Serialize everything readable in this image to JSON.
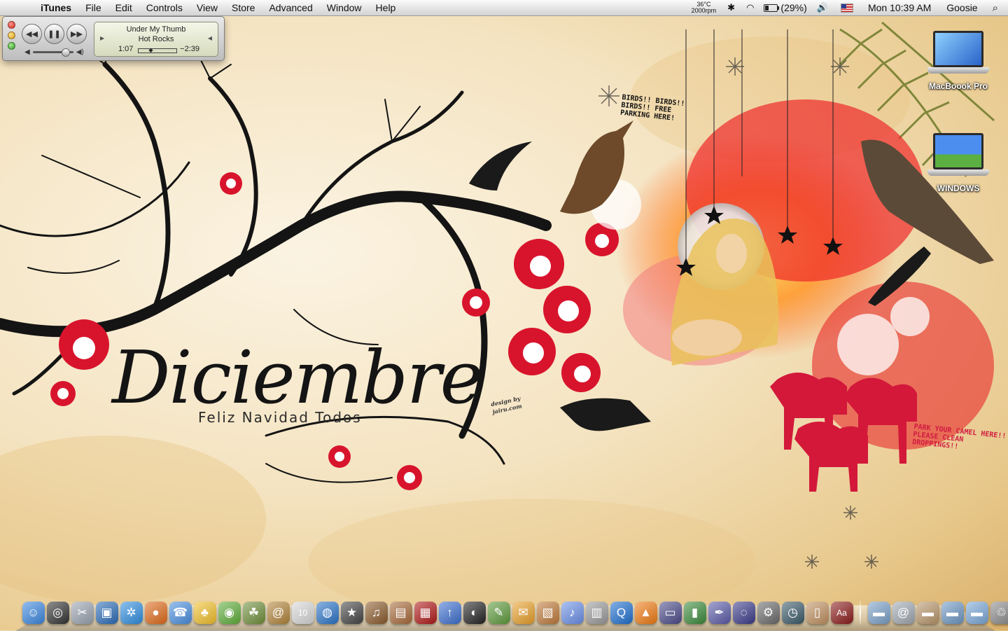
{
  "menubar": {
    "apple": "",
    "app": "iTunes",
    "menus": [
      "File",
      "Edit",
      "Controls",
      "View",
      "Store",
      "Advanced",
      "Window",
      "Help"
    ],
    "temperature": "36°C",
    "fan_speed": "2000rpm",
    "battery_text": "(29%)",
    "battery_level": 0.29,
    "clock": "Mon 10:39 AM",
    "user": "Goosie"
  },
  "player": {
    "song": "Under My Thumb",
    "album": "Hot Rocks",
    "elapsed": "1:07",
    "remaining": "−2:39",
    "progress": 0.3,
    "volume": 0.85
  },
  "wallpaper": {
    "title": "Diciembre",
    "subtitle": "Feliz Navidad Todos",
    "birds_text": "BIRDS!! BIRDS!! BIRDS!! FREE PARKING HERE!",
    "camel_text": "PARK YOUR CAMEL HERE!! PLEASE CLEAN DROPPINGS!!",
    "credit": "design by jairu.com"
  },
  "desktop": {
    "icons": [
      {
        "label": "MacBoook Pro",
        "icon": "macbook-pro-drive",
        "color": "#3b7fd9"
      },
      {
        "label": "WINDOWS",
        "icon": "windows-drive",
        "color": "#3c8de0"
      }
    ]
  },
  "dock": {
    "apps": [
      {
        "name": "finder",
        "glyph": "☺",
        "color": "#3b87e0"
      },
      {
        "name": "dashboard",
        "glyph": "◎",
        "color": "#333333"
      },
      {
        "name": "system-tools",
        "glyph": "✂",
        "color": "#9aa3b0"
      },
      {
        "name": "photo-browser",
        "glyph": "▣",
        "color": "#2b6cb8"
      },
      {
        "name": "safari",
        "glyph": "✲",
        "color": "#2f8ee0"
      },
      {
        "name": "firefox",
        "glyph": "●",
        "color": "#e06a1a"
      },
      {
        "name": "ichat",
        "glyph": "☎",
        "color": "#4a8fe0"
      },
      {
        "name": "cyberduck",
        "glyph": "♣",
        "color": "#f2c02a"
      },
      {
        "name": "app-green",
        "glyph": "◉",
        "color": "#5fae3a"
      },
      {
        "name": "yoda",
        "glyph": "☘",
        "color": "#6f8f3a"
      },
      {
        "name": "address-book",
        "glyph": "@",
        "color": "#b2843a"
      },
      {
        "name": "ical",
        "glyph": "10",
        "color": "#d8d8d8"
      },
      {
        "name": "itunes-dvd",
        "glyph": "◍",
        "color": "#2b74c8"
      },
      {
        "name": "imovie-star",
        "glyph": "★",
        "color": "#444444"
      },
      {
        "name": "garageband",
        "glyph": "♫",
        "color": "#8a5a2a"
      },
      {
        "name": "iphoto",
        "glyph": "▤",
        "color": "#a86a3a"
      },
      {
        "name": "photo-booth",
        "glyph": "▦",
        "color": "#b01818"
      },
      {
        "name": "flickr-uploader",
        "glyph": "↑",
        "color": "#3d6fd0"
      },
      {
        "name": "camera",
        "glyph": "◐",
        "color": "#222222"
      },
      {
        "name": "coda",
        "glyph": "✎",
        "color": "#5d9a3b"
      },
      {
        "name": "transmit",
        "glyph": "✉",
        "color": "#e9a02a"
      },
      {
        "name": "preview",
        "glyph": "▧",
        "color": "#c07a3a"
      },
      {
        "name": "itunes",
        "glyph": "♪",
        "color": "#6a8fe8"
      },
      {
        "name": "dvd-player",
        "glyph": "▥",
        "color": "#9a9a9a"
      },
      {
        "name": "quicktime",
        "glyph": "Q",
        "color": "#1e6fd0"
      },
      {
        "name": "vlc",
        "glyph": "▲",
        "color": "#f07a12"
      },
      {
        "name": "keynote",
        "glyph": "▭",
        "color": "#4a4a8a"
      },
      {
        "name": "grapher",
        "glyph": "▮",
        "color": "#3a8a3a"
      },
      {
        "name": "script-editor",
        "glyph": "✒",
        "color": "#5a5aa8"
      },
      {
        "name": "app-spiral",
        "glyph": "◌",
        "color": "#3a3a8a"
      },
      {
        "name": "system-preferences",
        "glyph": "⚙",
        "color": "#6a6a6a"
      },
      {
        "name": "time-machine",
        "glyph": "◷",
        "color": "#3a5a6a"
      },
      {
        "name": "stuffit",
        "glyph": "▯",
        "color": "#c09060"
      },
      {
        "name": "dictionary",
        "glyph": "Aa",
        "color": "#8b1a1a"
      }
    ],
    "folders": [
      {
        "name": "applications-folder",
        "glyph": "▬",
        "color": "#7aa0c8"
      },
      {
        "name": "network-folder",
        "glyph": "@",
        "color": "#9fa8b2"
      },
      {
        "name": "documents-folder",
        "glyph": "▬",
        "color": "#b8956a"
      },
      {
        "name": "pictures-folder",
        "glyph": "▬",
        "color": "#6d98c4"
      },
      {
        "name": "downloads-folder",
        "glyph": "▬",
        "color": "#7aa7d8"
      },
      {
        "name": "trash",
        "glyph": "♲",
        "color": "#8a8a8a"
      }
    ]
  }
}
